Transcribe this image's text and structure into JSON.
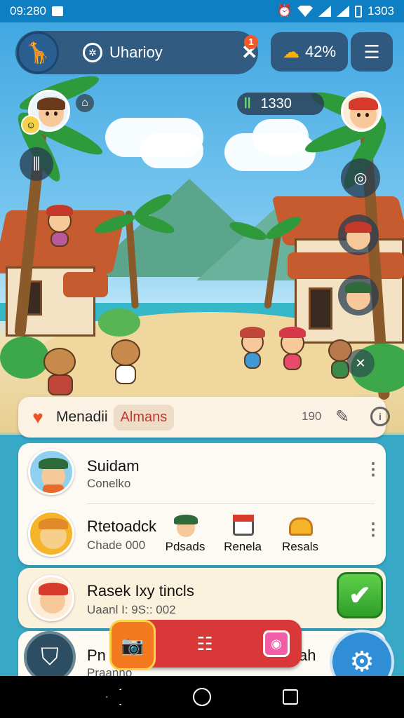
{
  "status_bar": {
    "time": "09:280",
    "battery": "1303"
  },
  "hud": {
    "player_name": "Uharioy",
    "notification_count": "1",
    "energy_percent": "42%",
    "resource_value": "1330"
  },
  "tab_bar": {
    "label": "Menadii",
    "chip": "Almans",
    "count": "190"
  },
  "list": {
    "rows": [
      {
        "title": "Suidam",
        "subtitle": "Conelko"
      },
      {
        "title": "Rtetoadck",
        "subtitle": "Chade 000"
      },
      {
        "title": "Rasek Ixy tincls",
        "subtitle": "Uaanl I: 9S:: 002"
      },
      {
        "title": "Pn",
        "subtitle": "Praanno",
        "right_text": "ah"
      }
    ],
    "mini_items": [
      {
        "label": "Pdsads",
        "icon": "villager-head-icon"
      },
      {
        "label": "Renela",
        "icon": "house-icon"
      },
      {
        "label": "Resals",
        "icon": "basket-icon"
      }
    ]
  },
  "colors": {
    "status_bar": "#0e7fc2",
    "accent_red": "#d93838",
    "accent_green": "#2f9e2a",
    "accent_blue": "#2f8ed6"
  }
}
